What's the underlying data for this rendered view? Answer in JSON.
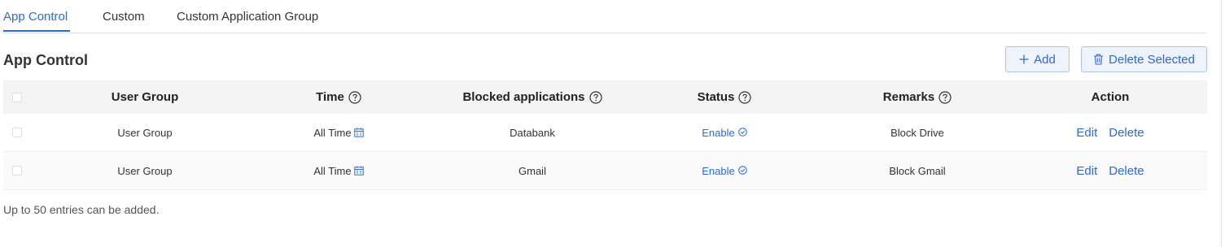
{
  "tabs": [
    {
      "label": "App Control",
      "active": true
    },
    {
      "label": "Custom",
      "active": false
    },
    {
      "label": "Custom Application Group",
      "active": false
    }
  ],
  "section": {
    "title": "App Control"
  },
  "toolbar": {
    "add_label": "Add",
    "add_icon": "plus-icon",
    "delete_label": "Delete Selected",
    "delete_icon": "trash-icon"
  },
  "table": {
    "columns": {
      "user_group": "User Group",
      "time": "Time",
      "blocked_apps": "Blocked applications",
      "status": "Status",
      "remarks": "Remarks",
      "action": "Action"
    },
    "rows": [
      {
        "user_group": "User Group",
        "time": "All Time",
        "blocked_apps": "Databank",
        "status": "Enable",
        "remarks": "Block Drive",
        "edit": "Edit",
        "delete": "Delete"
      },
      {
        "user_group": "User Group",
        "time": "All Time",
        "blocked_apps": "Gmail",
        "status": "Enable",
        "remarks": "Block Gmail",
        "edit": "Edit",
        "delete": "Delete"
      }
    ]
  },
  "footer": {
    "note": "Up to 50 entries can be added."
  },
  "colors": {
    "accent": "#2d6ad8",
    "header_bg": "#f4f4f4",
    "button_bg": "#eef3fc"
  }
}
